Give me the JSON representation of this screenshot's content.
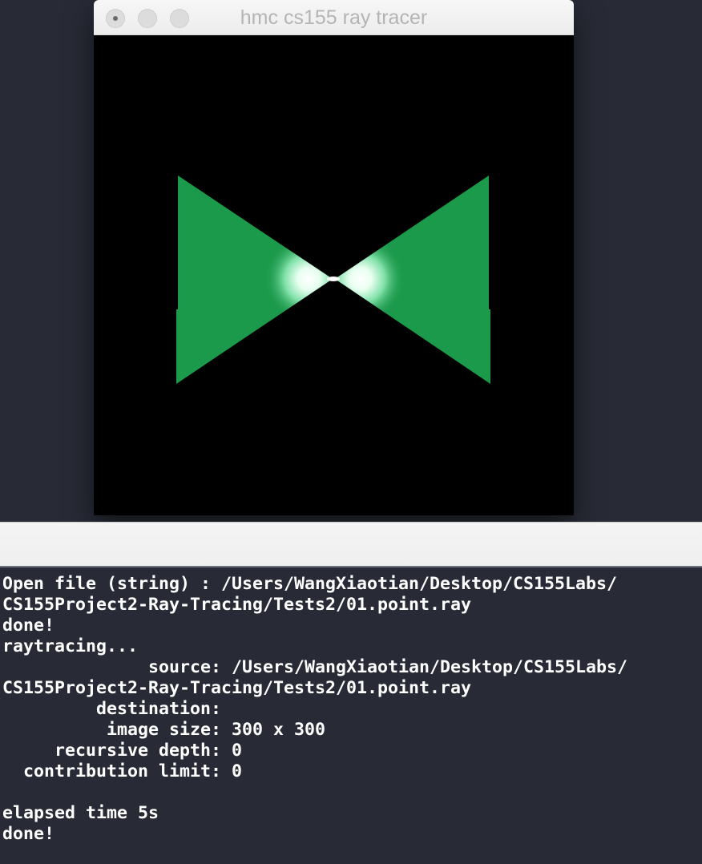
{
  "window": {
    "title": "hmc cs155 ray tracer",
    "buttons": [
      "close",
      "minimize",
      "zoom"
    ]
  },
  "render": {
    "background_color": "#000000",
    "shape_color": "#1c9a4c",
    "highlight_color": "#ffffff",
    "description_icon": "bowtie-render"
  },
  "console": {
    "lines": [
      "Open file (string) : /Users/WangXiaotian/Desktop/CS155Labs/",
      "CS155Project2-Ray-Tracing/Tests2/01.point.ray",
      "done!",
      "raytracing...",
      "              source: /Users/WangXiaotian/Desktop/CS155Labs/",
      "CS155Project2-Ray-Tracing/Tests2/01.point.ray",
      "         destination: ",
      "          image size: 300 x 300",
      "     recursive depth: 0",
      "  contribution limit: 0",
      "",
      "elapsed time 5s",
      "done!"
    ]
  }
}
